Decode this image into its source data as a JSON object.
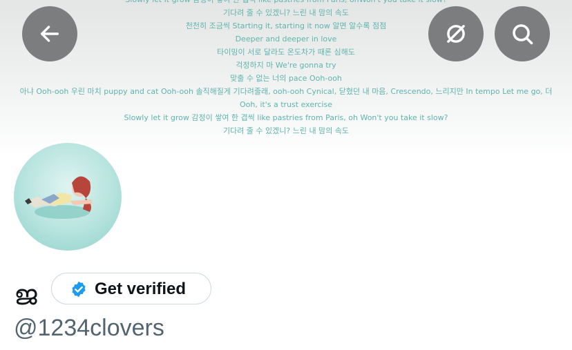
{
  "header": {
    "banner_lyrics": [
      "Slowly let it grow 감정이 쌓여 한 겹씩 like pastries from Paris, ohWon't you take it slow?",
      "기다려 줄 수 있겠니? 느린 내 맘의 속도",
      "천천히 조금씩 Starting it, starting it now 알면 알수록 점점",
      "Deeper and deeper in love",
      "타이밍이 서로 달라도 온도차가 때론 심해도",
      "걱정하지 마 We're gonna try",
      "맞출 수 없는 너의 pace Ooh-ooh",
      "아냐 Ooh-ooh 우린 마치 puppy and cat Ooh-ooh 솔직해질게 기다려줄래, ooh-ooh Cynical, 닫혔던 내 마음, Crescendo, 느리지만 In tempo Let me go, 더",
      "Ooh, it's a trust exercise",
      "Slowly let it grow 감정이 쌓여 한 겹씩 like pastries from Paris, oh Won't you take it slow?",
      "기다려 줄 수 있겠니? 느린 내 맘의 속도"
    ],
    "back_icon": "arrow-left-icon",
    "link_off_icon": "crossed-circle-icon",
    "search_icon": "search-icon"
  },
  "profile": {
    "name": "ജ",
    "verify_label": "Get verified",
    "verify_icon": "verified-badge-icon",
    "handle": "@1234clovers"
  },
  "colors": {
    "lyric_text": "#5fb3ad",
    "icon_button_bg": "#7b7d7f",
    "verified_blue": "#1d9bf0",
    "handle_gray": "#536471"
  }
}
